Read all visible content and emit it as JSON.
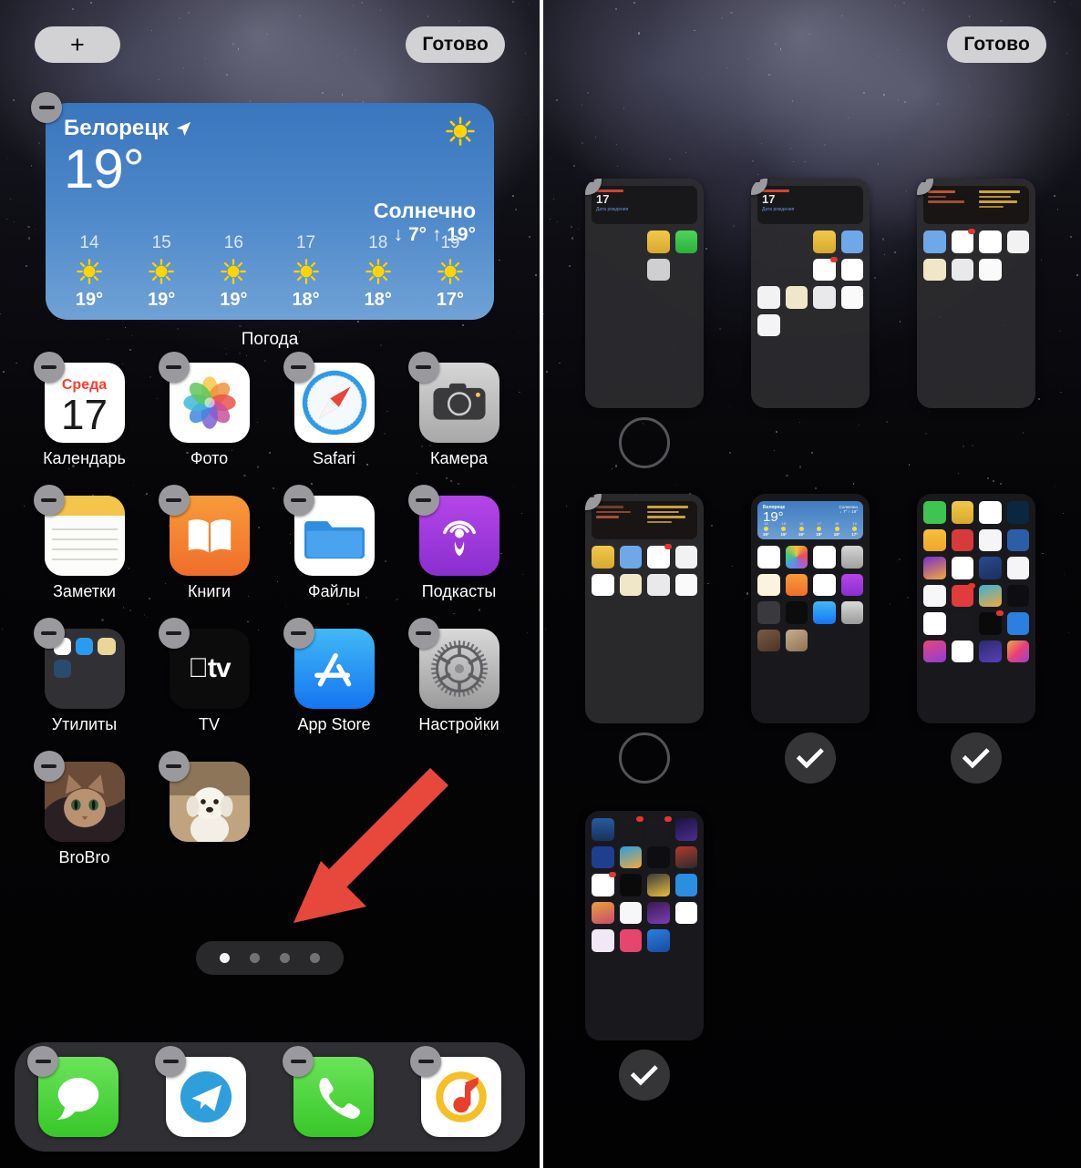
{
  "left_panel": {
    "toolbar": {
      "add_label": "+",
      "done_label": "Готово"
    },
    "widget": {
      "app_label": "Погода",
      "city": "Белорецк",
      "location_icon": "location-arrow-icon",
      "current_temp": "19°",
      "condition": "Солнечно",
      "hilo": "↓ 7° ↑ 19°",
      "condition_icon": "sun-icon",
      "forecast": [
        {
          "day": "14",
          "icon": "sun-icon",
          "temp": "19°"
        },
        {
          "day": "15",
          "icon": "sun-icon",
          "temp": "19°"
        },
        {
          "day": "16",
          "icon": "sun-icon",
          "temp": "19°"
        },
        {
          "day": "17",
          "icon": "sun-icon",
          "temp": "18°"
        },
        {
          "day": "18",
          "icon": "sun-icon",
          "temp": "18°"
        },
        {
          "day": "19",
          "icon": "sun-icon",
          "temp": "17°"
        }
      ]
    },
    "apps": [
      {
        "label": "Календарь",
        "icon": "calendar-icon",
        "weekday": "Среда",
        "date": "17"
      },
      {
        "label": "Фото",
        "icon": "photos-icon"
      },
      {
        "label": "Safari",
        "icon": "safari-icon"
      },
      {
        "label": "Камера",
        "icon": "camera-icon"
      },
      {
        "label": "Заметки",
        "icon": "notes-icon"
      },
      {
        "label": "Книги",
        "icon": "books-icon"
      },
      {
        "label": "Файлы",
        "icon": "files-icon"
      },
      {
        "label": "Подкасты",
        "icon": "podcasts-icon"
      },
      {
        "label": "Утилиты",
        "icon": "folder-icon"
      },
      {
        "label": "TV",
        "icon": "appletv-icon"
      },
      {
        "label": "App Store",
        "icon": "appstore-icon"
      },
      {
        "label": "Настройки",
        "icon": "settings-icon"
      },
      {
        "label": "BroBro",
        "icon": "photo-widget-cat-icon"
      },
      {
        "label": "",
        "icon": "photo-widget-dog-icon"
      }
    ],
    "page_dots": {
      "count": 4,
      "active_index": 0
    },
    "dock": [
      {
        "label": "Сообщения",
        "icon": "messages-icon"
      },
      {
        "label": "Telegram",
        "icon": "telegram-icon"
      },
      {
        "label": "Телефон",
        "icon": "phone-icon"
      },
      {
        "label": "Яндекс Музыка",
        "icon": "yandex-music-icon"
      }
    ],
    "annotation": {
      "type": "red-arrow",
      "points_to": "page-dots"
    }
  },
  "right_panel": {
    "toolbar": {
      "done_label": "Готово"
    },
    "pages": [
      {
        "index": 1,
        "checked": false,
        "type": "widgets-calendar"
      },
      {
        "index": 2,
        "checked": false,
        "type": "widgets-calendar-apps"
      },
      {
        "index": 3,
        "checked": false,
        "type": "widgets-notes-apps"
      },
      {
        "index": 4,
        "checked": false,
        "type": "widgets-notes-apps"
      },
      {
        "index": 5,
        "checked": true,
        "type": "home-weather"
      },
      {
        "index": 6,
        "checked": true,
        "type": "apps-grid-color"
      },
      {
        "index": 7,
        "checked": true,
        "type": "apps-grid-dark"
      }
    ]
  },
  "colors": {
    "accent_red": "#e8473c",
    "pill_bg": "#d2d2d4",
    "minus_badge": "#9a9a9e",
    "widget_blue": "#4c87c9",
    "sun_yellow": "#ffd83d"
  }
}
